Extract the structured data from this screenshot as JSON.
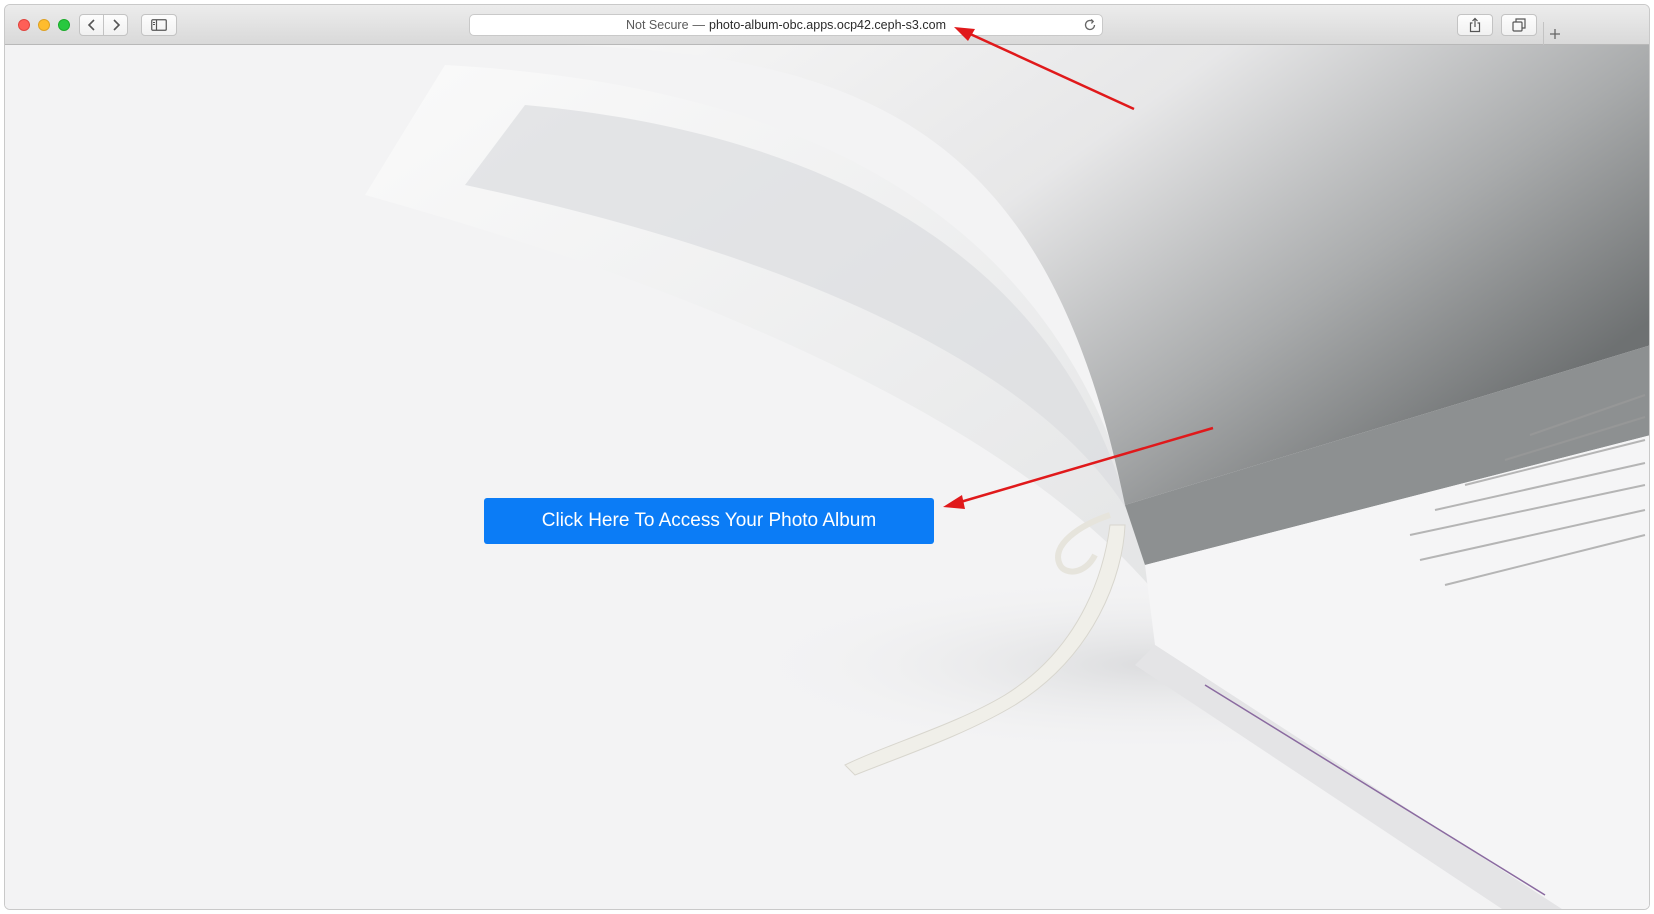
{
  "browser": {
    "url_security": "Not Secure",
    "url_separator": "—",
    "url_host": "photo-album-obc.apps.ocp42.ceph-s3.com"
  },
  "page": {
    "cta_label": "Click Here To Access Your Photo Album"
  },
  "colors": {
    "cta_background": "#0b7cf6",
    "annotation_arrow": "#e0191b"
  },
  "icons": {
    "back": "chevron-left-icon",
    "forward": "chevron-right-icon",
    "sidebar": "sidebar-icon",
    "reload": "reload-icon",
    "share": "share-icon",
    "tabs": "tab-overview-icon",
    "new_tab": "plus-icon"
  }
}
